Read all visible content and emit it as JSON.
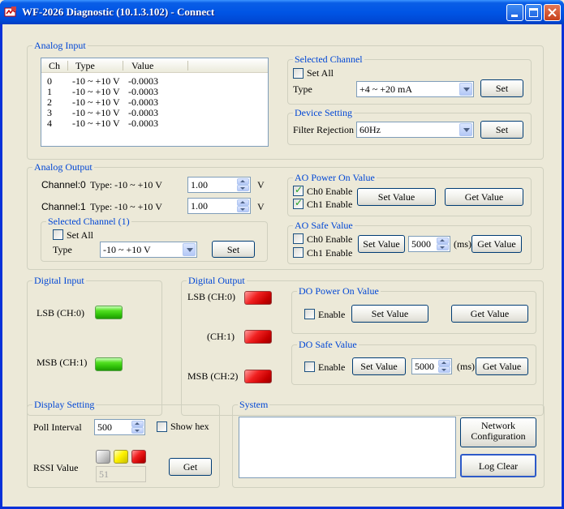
{
  "window": {
    "title": "WF-2026 Diagnostic (10.1.3.102) - Connect"
  },
  "analog_input": {
    "group_label": "Analog Input",
    "columns": [
      "Ch",
      "Type",
      "Value"
    ],
    "rows": [
      {
        "ch": "0",
        "type": "-10 ~ +10 V",
        "value": "-0.0003"
      },
      {
        "ch": "1",
        "type": "-10 ~ +10 V",
        "value": "-0.0003"
      },
      {
        "ch": "2",
        "type": "-10 ~ +10 V",
        "value": "-0.0003"
      },
      {
        "ch": "3",
        "type": "-10 ~ +10 V",
        "value": "-0.0003"
      },
      {
        "ch": "4",
        "type": "-10 ~ +10 V",
        "value": "-0.0003"
      }
    ]
  },
  "selected_channel": {
    "group_label": "Selected Channel",
    "set_all_label": "Set All",
    "type_label": "Type",
    "type_value": "+4 ~ +20 mA",
    "set_label": "Set"
  },
  "device_setting": {
    "group_label": "Device Setting",
    "filter_label": "Filter Rejection",
    "filter_value": "60Hz",
    "set_label": "Set"
  },
  "analog_output": {
    "group_label": "Analog Output",
    "ch0_label": "Channel:0",
    "ch0_type": "Type: -10 ~ +10 V",
    "ch0_value": "1.00",
    "ch1_label": "Channel:1",
    "ch1_type": "Type: -10 ~ +10 V",
    "ch1_value": "1.00",
    "unit": "V",
    "selected": {
      "group_label": "Selected Channel (1)",
      "set_all_label": "Set All",
      "type_label": "Type",
      "type_value": "-10 ~ +10 V",
      "set_label": "Set"
    }
  },
  "ao_power_on": {
    "group_label": "AO Power On Value",
    "ch0_label": "Ch0 Enable",
    "ch0_checked": true,
    "ch1_label": "Ch1 Enable",
    "ch1_checked": true,
    "set_value_label": "Set Value",
    "get_value_label": "Get Value"
  },
  "ao_safe": {
    "group_label": "AO Safe Value",
    "ch0_label": "Ch0 Enable",
    "ch1_label": "Ch1 Enable",
    "set_value_label": "Set Value",
    "timeout_value": "5000",
    "unit": "(ms)",
    "get_value_label": "Get Value"
  },
  "digital_input": {
    "group_label": "Digital Input",
    "lsb_label": "LSB (CH:0)",
    "msb_label": "MSB (CH:1)"
  },
  "digital_output": {
    "group_label": "Digital Output",
    "lsb_label": "LSB (CH:0)",
    "ch1_label": "(CH:1)",
    "msb_label": "MSB (CH:2)"
  },
  "do_power_on": {
    "group_label": "DO Power On Value",
    "enable_label": "Enable",
    "set_value_label": "Set Value",
    "get_value_label": "Get Value"
  },
  "do_safe": {
    "group_label": "DO Safe Value",
    "enable_label": "Enable",
    "set_value_label": "Set Value",
    "timeout_value": "5000",
    "unit": "(ms)",
    "get_value_label": "Get Value"
  },
  "display_setting": {
    "group_label": "Display Setting",
    "poll_label": "Poll Interval",
    "poll_value": "500",
    "show_hex_label": "Show hex",
    "rssi_label": "RSSI Value",
    "rssi_value": "51",
    "get_label": "Get"
  },
  "system": {
    "group_label": "System",
    "network_label_line1": "Network",
    "network_label_line2": "Configuration",
    "log_clear_label": "Log Clear"
  },
  "colors": {
    "group_label": "#0046d5",
    "led_on_green": "#2fbf08",
    "led_on_red": "#c80000"
  }
}
